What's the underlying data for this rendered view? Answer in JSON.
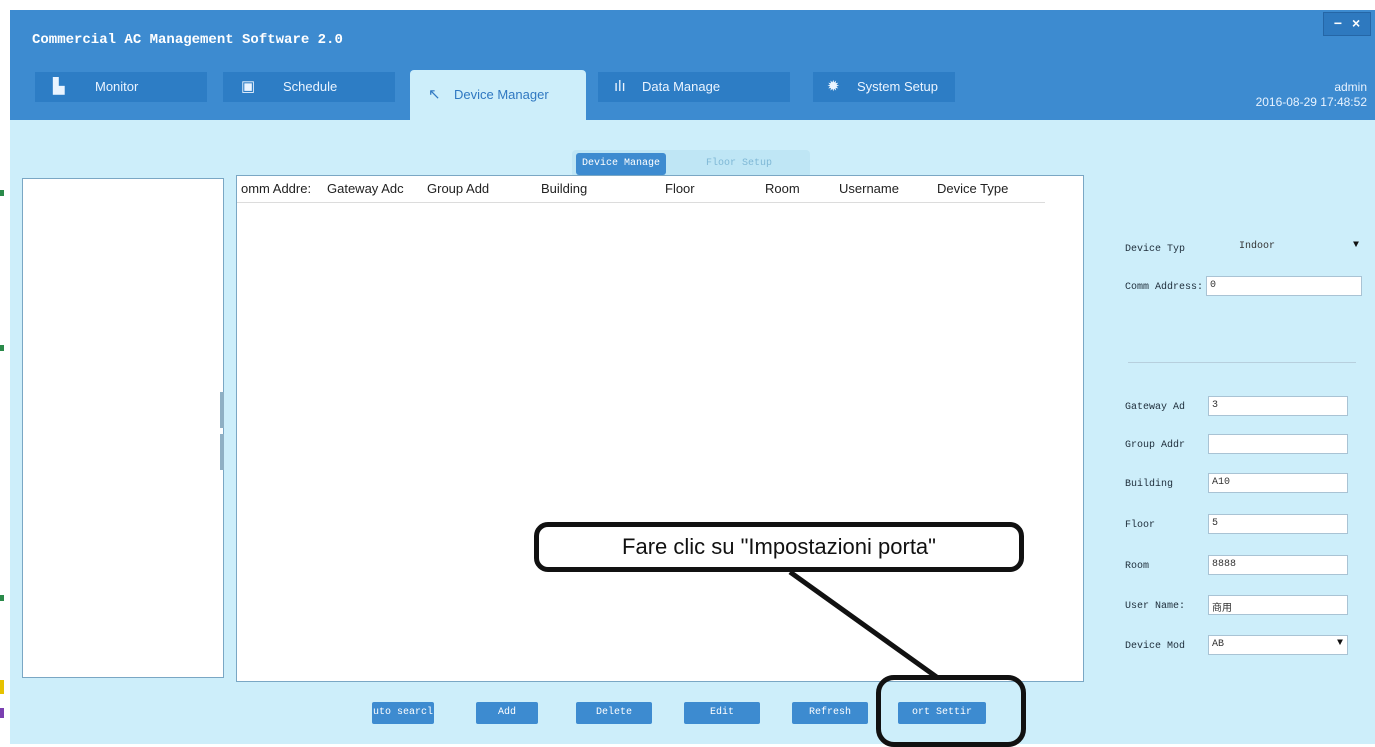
{
  "window": {
    "title": "Commercial AC Management Software 2.0",
    "controls": [
      "−",
      "×"
    ]
  },
  "tabs": [
    {
      "label": "Monitor",
      "icon": "monitor-icon",
      "glyph": "▙",
      "active": false
    },
    {
      "label": "Schedule",
      "icon": "calendar-icon",
      "glyph": "▣",
      "active": false
    },
    {
      "label": "Device Manager",
      "icon": "wrench-icon",
      "glyph": "↖",
      "active": true
    },
    {
      "label": "Data Manage",
      "icon": "bar-chart-icon",
      "glyph": "ılı",
      "active": false
    },
    {
      "label": "System Setup",
      "icon": "gear-icon",
      "glyph": "✹",
      "active": false
    }
  ],
  "user": {
    "name": "admin",
    "datetime": "2016-08-29 17:48:52"
  },
  "subtabs": [
    {
      "label": "Device Manage",
      "active": true
    },
    {
      "label": "Floor Setup",
      "active": false
    }
  ],
  "table": {
    "columns": [
      "omm Addre:",
      "Gateway Adc",
      "Group Add",
      "Building",
      "Floor",
      "Room",
      "Username",
      "Device Type"
    ],
    "rows": []
  },
  "form": {
    "device_type": {
      "label": "Device Typ",
      "value": "Indoor"
    },
    "comm_address": {
      "label": "Comm Address:",
      "value": "0"
    },
    "gateway_address": {
      "label": "Gateway Ad",
      "value": "3"
    },
    "group_address": {
      "label": "Group Addr",
      "value": ""
    },
    "building": {
      "label": "Building",
      "value": "A10"
    },
    "floor": {
      "label": "Floor",
      "value": "5"
    },
    "room": {
      "label": "Room",
      "value": "8888"
    },
    "user_name": {
      "label": "User Name:",
      "value": "商用"
    },
    "device_mode": {
      "label": "Device Mod",
      "value": "AB"
    }
  },
  "buttons": {
    "auto_search": "uto searcl",
    "add": "Add",
    "delete": "Delete",
    "edit": "Edit",
    "refresh": "Refresh",
    "port_setting": "ort Settir"
  },
  "annotation": {
    "text": "Fare clic su \"Impostazioni porta\""
  },
  "colors": {
    "titlebar": "#3d8bd0",
    "tab_bg": "#2d7dc5",
    "body_bg": "#cdeefa",
    "button": "#3d8bd0"
  }
}
